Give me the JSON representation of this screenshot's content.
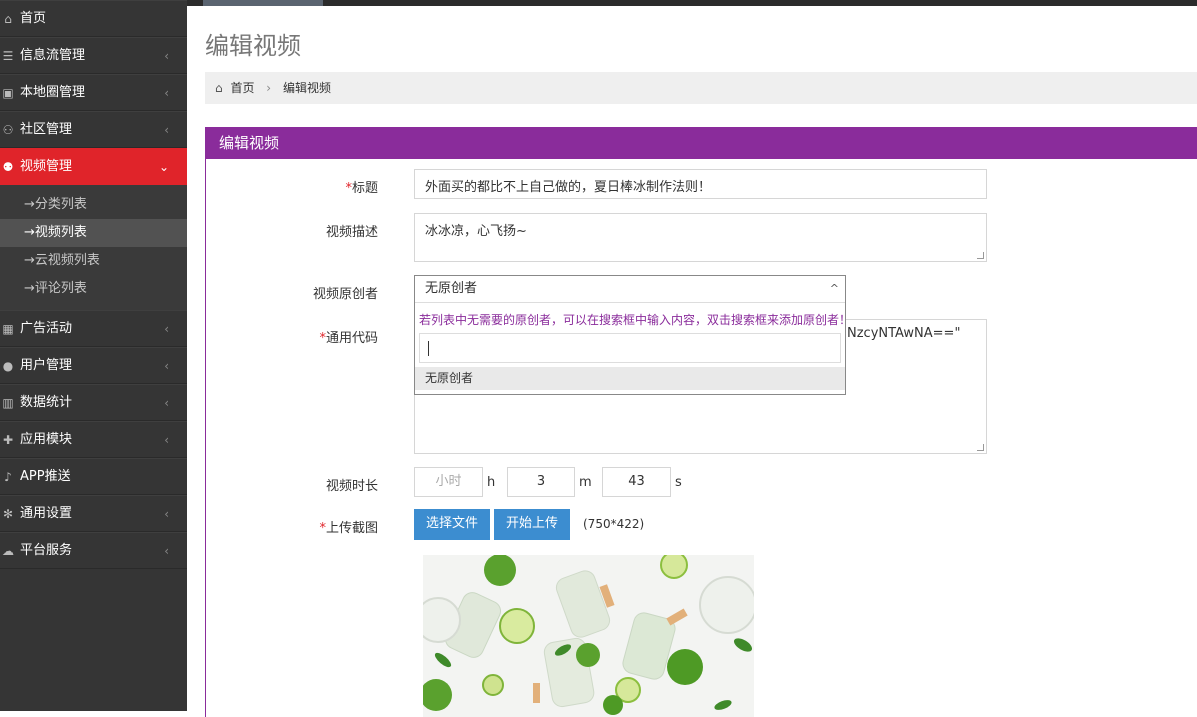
{
  "sidebar": {
    "items": [
      {
        "label": "首页",
        "icon": "home-icon",
        "glyph": "⌂"
      },
      {
        "label": "信息流管理",
        "icon": "list-icon",
        "glyph": "☰",
        "chevron": "‹"
      },
      {
        "label": "本地圈管理",
        "icon": "camera-icon",
        "glyph": "▣",
        "chevron": "‹"
      },
      {
        "label": "社区管理",
        "icon": "users-icon",
        "glyph": "⚇",
        "chevron": "‹"
      },
      {
        "label": "视频管理",
        "icon": "group-icon",
        "glyph": "⚉",
        "chevron": "⌄",
        "active": true
      },
      {
        "label": "广告活动",
        "icon": "calendar-icon",
        "glyph": "▦",
        "chevron": "‹"
      },
      {
        "label": "用户管理",
        "icon": "user-icon",
        "glyph": "●",
        "chevron": "‹"
      },
      {
        "label": "数据统计",
        "icon": "bar-chart-icon",
        "glyph": "▥",
        "chevron": "‹"
      },
      {
        "label": "应用模块",
        "icon": "puzzle-icon",
        "glyph": "✚",
        "chevron": "‹"
      },
      {
        "label": "APP推送",
        "icon": "bell-icon",
        "glyph": "♪"
      },
      {
        "label": "通用设置",
        "icon": "gears-icon",
        "glyph": "✻",
        "chevron": "‹"
      },
      {
        "label": "平台服务",
        "icon": "cloud-icon",
        "glyph": "☁",
        "chevron": "‹"
      }
    ],
    "sub_items": [
      "→分类列表",
      "→视频列表",
      "→云视频列表",
      "→评论列表"
    ],
    "active_sub": 1
  },
  "header": {
    "title": "编辑视频",
    "breadcrumb": {
      "home": "首页",
      "separator": "›",
      "current": "编辑视频"
    }
  },
  "panel": {
    "title": "编辑视频",
    "fields": {
      "title": {
        "required": "*",
        "label": "标题",
        "value": "外面买的都比不上自己做的，夏日棒冰制作法则！"
      },
      "description": {
        "label": "视频描述",
        "value": "冰冰凉，心飞扬~"
      },
      "creator": {
        "label": "视频原创者",
        "value": "无原创者",
        "caret": "^",
        "hint": "若列表中无需要的原创者，可以在搜索框中输入内容，双击搜索框来添加原创者！",
        "option": "无原创者"
      },
      "code": {
        "required": "*",
        "label": "通用代码",
        "visible_value": "NzcyNTAwNA==\""
      },
      "duration": {
        "label": "视频时长",
        "hours_placeholder": "小时",
        "hours_unit": "h",
        "minutes": "3",
        "minutes_unit": "m",
        "seconds": "43",
        "seconds_unit": "s"
      },
      "screenshot": {
        "required": "*",
        "label": "上传截图",
        "choose_button": "选择文件",
        "upload_button": "开始上传",
        "size_hint": "(750*422)"
      }
    }
  },
  "colors": {
    "sidebar_bg": "#353535",
    "active_red": "#e0242a",
    "panel_purple": "#8a2c9b",
    "button_blue": "#3c8dd0"
  }
}
